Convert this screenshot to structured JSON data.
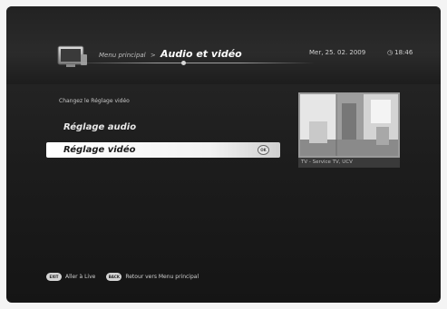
{
  "header": {
    "breadcrumb_parent": "Menu principal",
    "separator": ">",
    "title": "Audio et vidéo",
    "date": "Mer, 25. 02. 2009",
    "time": "18:46"
  },
  "hint": "Changez le Réglage vidéo",
  "menu": {
    "items": [
      {
        "label": "Réglage audio",
        "selected": false
      },
      {
        "label": "Réglage vidéo",
        "selected": true
      }
    ],
    "ok_label": "OK"
  },
  "preview": {
    "caption": "TV - Service TV, UCV"
  },
  "footer": {
    "exit_key": "EXIT",
    "exit_label": "Aller à Live",
    "back_key": "BACK",
    "back_label": "Retour vers Menu principal"
  },
  "icons": {
    "header": "tv-icon",
    "time": "clock-icon"
  }
}
